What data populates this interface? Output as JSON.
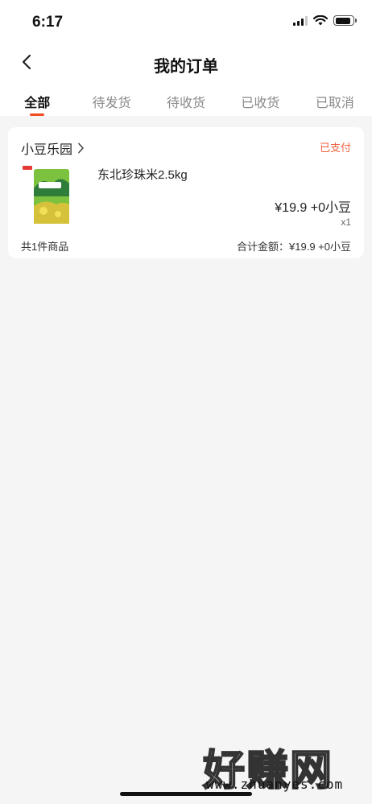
{
  "status_bar": {
    "time": "6:17"
  },
  "header": {
    "title": "我的订单"
  },
  "tabs": [
    {
      "label": "全部",
      "active": true
    },
    {
      "label": "待发货",
      "active": false
    },
    {
      "label": "待收货",
      "active": false
    },
    {
      "label": "已收货",
      "active": false
    },
    {
      "label": "已取消",
      "active": false
    }
  ],
  "order": {
    "shop_name": "小豆乐园",
    "status": "已支付",
    "product": {
      "name": "东北珍珠米2.5kg",
      "price": "¥19.9 +0小豆",
      "quantity": "x1",
      "image_icon": "rice-bag-image"
    },
    "summary": {
      "count_text": "共1件商品",
      "total_text": "合计金额：¥19.9 +0小豆"
    }
  },
  "watermark": {
    "text": "好赚网",
    "sub": "www.zhuanyes.com"
  },
  "colors": {
    "accent": "#f04b22",
    "status": "#f2623e"
  }
}
